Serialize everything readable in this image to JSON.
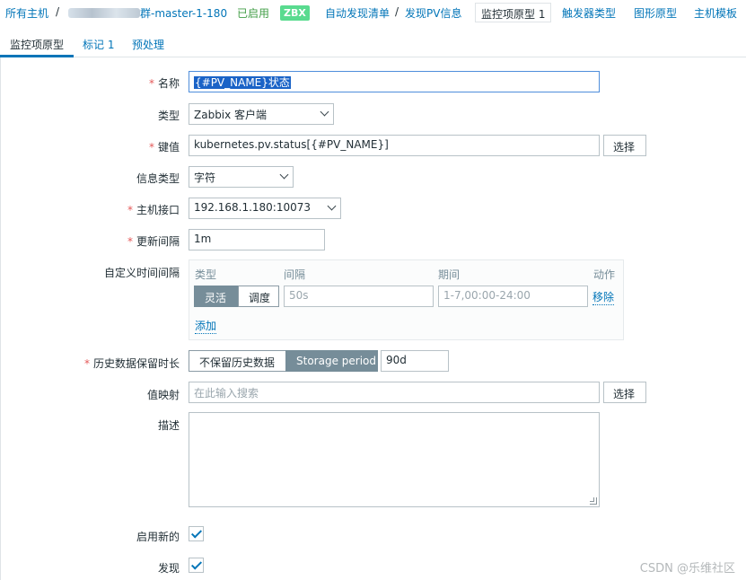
{
  "breadcrumb": {
    "all_hosts": "所有主机",
    "sep": "/",
    "host": "群-master-1-180",
    "enabled": "已启用",
    "zbx": "ZBX",
    "discovery_list": "自动发现清单",
    "discovery_rule": "发现PV信息",
    "item_prototypes": "监控项原型 1",
    "trigger_types": "触发器类型",
    "graph_prototypes": "图形原型",
    "host_templates": "主机模板"
  },
  "tabs": [
    {
      "label": "监控项原型"
    },
    {
      "label": "标记 1"
    },
    {
      "label": "预处理"
    }
  ],
  "form": {
    "name_label": "名称",
    "name_value": "{#PV_NAME}状态",
    "type_label": "类型",
    "type_value": "Zabbix 客户端",
    "key_label": "键值",
    "key_value": "kubernetes.pv.status[{#PV_NAME}]",
    "select_btn": "选择",
    "info_type_label": "信息类型",
    "info_type_value": "字符",
    "interface_label": "主机接口",
    "interface_value": "192.168.1.180:10073",
    "interval_label": "更新间隔",
    "interval_value": "1m",
    "custom_label": "自定义时间间隔",
    "custom": {
      "col_type": "类型",
      "col_interval": "间隔",
      "col_period": "期间",
      "col_action": "动作",
      "flexible": "灵活",
      "scheduling": "调度",
      "interval_placeholder": "50s",
      "period_placeholder": "1-7,00:00-24:00",
      "remove": "移除",
      "add": "添加"
    },
    "history_label": "历史数据保留时长",
    "history_no_keep": "不保留历史数据",
    "history_storage": "Storage period",
    "history_value": "90d",
    "valuemap_label": "值映射",
    "valuemap_placeholder": "在此输入搜索",
    "valuemap_btn": "选择",
    "desc_label": "描述",
    "enable_label": "启用新的",
    "discover_label": "发现"
  },
  "watermark": "CSDN @乐维社区",
  "colors": {
    "link": "#0275b8",
    "enabled": "#429e47",
    "zbx_badge": "#59db8f",
    "required": "#e45959",
    "segment_on": "#768d99"
  }
}
